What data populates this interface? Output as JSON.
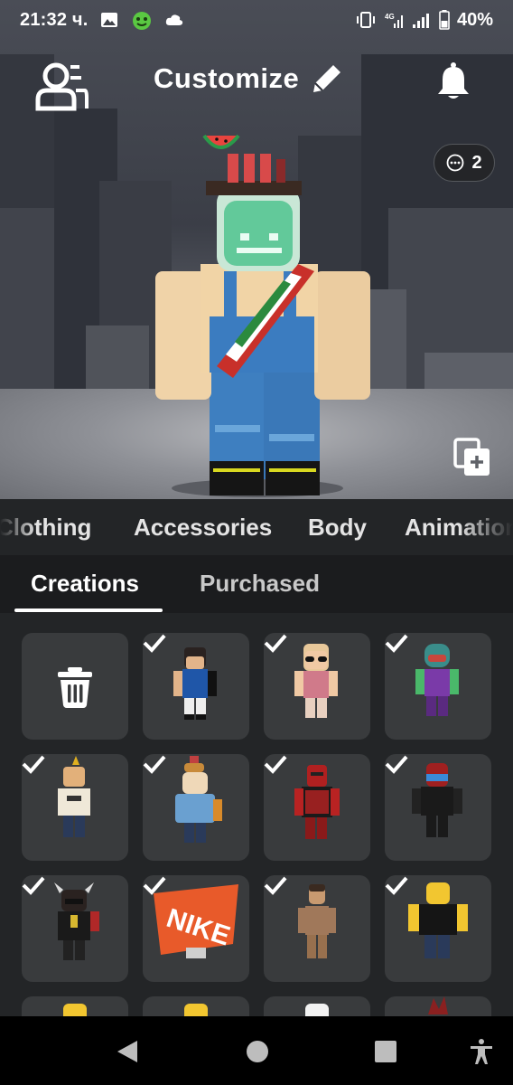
{
  "status_bar": {
    "time": "21:32 ч.",
    "battery": "40%"
  },
  "header": {
    "title": "Customize"
  },
  "outfits_badge": {
    "count": "2"
  },
  "categories": [
    "Clothing",
    "Accessories",
    "Body",
    "Animations"
  ],
  "subtabs": {
    "active": "Creations",
    "inactive": "Purchased"
  },
  "grid": {
    "first_tile": "delete",
    "outfits": [
      "dark-hair-blue-shirt",
      "blonde-sunglasses-pink",
      "helmet-purple-green",
      "mohawk-white-shirt",
      "burger-hat-blue-hoodie",
      "red-masked-suit",
      "red-hair-black-outfit",
      "horned-black-gold",
      "nike-box",
      "brown-suit",
      "yellow-noob-black"
    ]
  },
  "colors": {
    "background": "#232527",
    "tile": "#393b3d",
    "active_underline": "#ffffff"
  }
}
